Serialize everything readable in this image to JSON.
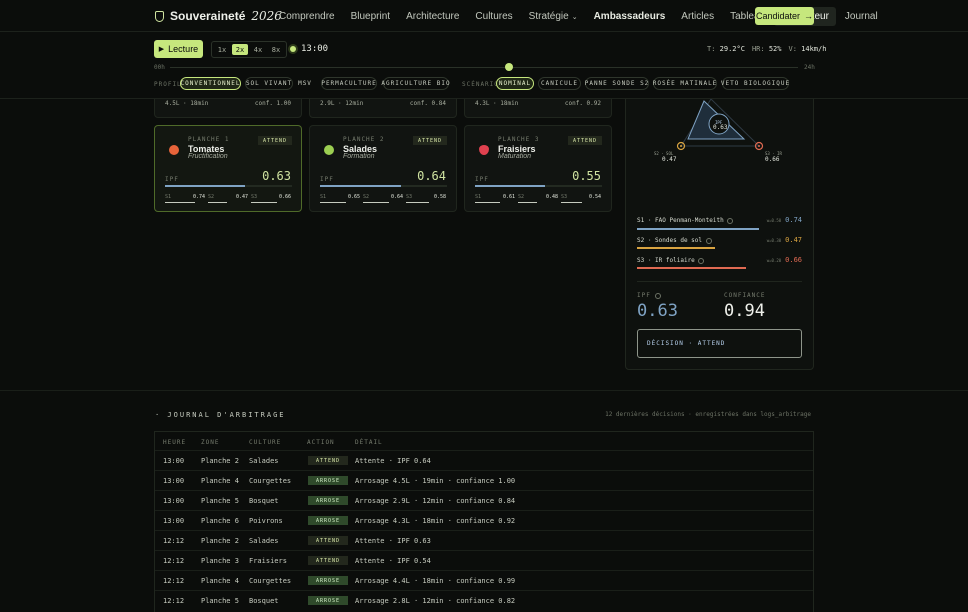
{
  "nav": {
    "brand": "Souveraineté",
    "brand_year": "2026",
    "links": [
      "Comprendre",
      "Blueprint",
      "Architecture",
      "Cultures",
      "Stratégie",
      "Ambassadeurs",
      "Articles",
      "Tableau",
      "Simulateur",
      "Journal"
    ],
    "active": "Simulateur",
    "cta": "Candidater"
  },
  "controls": {
    "play_label": "Lecture",
    "speeds": [
      "1x",
      "2x",
      "4x",
      "8x"
    ],
    "speed_selected": "2x",
    "time": "13:00",
    "weather": {
      "t_label": "T",
      "t": "29.2°C",
      "hr_label": "HR",
      "hr": "52%",
      "v_label": "V",
      "v": "14km/h"
    },
    "timeline_start": "00h",
    "timeline_end": "24h",
    "timeline_progress": 0.54,
    "profil_label": "PROFIL",
    "profils": [
      "CONVENTIONNEL",
      "SOL VIVANT",
      "MSV",
      "PERMACULTURE",
      "AGRICULTURE BIO"
    ],
    "profil_selected": "CONVENTIONNEL",
    "scenario_label": "SCÉNARIO",
    "scenarios": [
      "NOMINAL",
      "CANICULE",
      "PANNE SONDE S2",
      "ROSÉE MATINALE",
      "VETO BIOLOGIQUE"
    ],
    "scenario_selected": "NOMINAL"
  },
  "top_cards": [
    {
      "left": "4.5L · 18min",
      "right": "conf. 1.00"
    },
    {
      "left": "2.9L · 12min",
      "right": "conf. 0.84"
    },
    {
      "left": "4.3L · 18min",
      "right": "conf. 0.92"
    }
  ],
  "plots": [
    {
      "label": "PLANCHE 1",
      "name": "Tomates",
      "stage": "Fructification",
      "state": "ATTEND",
      "ipf_label": "IPF",
      "ipf": "0.63",
      "ipf_value": 0.63,
      "s1_label": "S1",
      "s1": "0.74",
      "s2_label": "S2",
      "s2": "0.47",
      "s3_label": "S3",
      "s3": "0.66",
      "icon_color": "#e8643a",
      "icon": "tomato-icon"
    },
    {
      "label": "PLANCHE 2",
      "name": "Salades",
      "stage": "Formation",
      "state": "ATTEND",
      "ipf_label": "IPF",
      "ipf": "0.64",
      "ipf_value": 0.64,
      "s1_label": "S1",
      "s1": "0.65",
      "s2_label": "S2",
      "s2": "0.64",
      "s3_label": "S3",
      "s3": "0.58",
      "icon_color": "#9ccf52",
      "icon": "salad-icon"
    },
    {
      "label": "PLANCHE 3",
      "name": "Fraisiers",
      "stage": "Maturation",
      "state": "ATTEND",
      "ipf_label": "IPF",
      "ipf": "0.55",
      "ipf_value": 0.55,
      "s1_label": "S1",
      "s1": "0.61",
      "s2_label": "S2",
      "s2": "0.48",
      "s3_label": "S3",
      "s3": "0.54",
      "icon_color": "#e0414f",
      "icon": "strawberry-icon"
    }
  ],
  "panel": {
    "triangle": {
      "center_label": "IPF",
      "center_value": "0.63",
      "s2_label": "S2 · SOL",
      "s2_value": "0.47",
      "s3_label": "S3 · IR",
      "s3_value": "0.66"
    },
    "sensors": [
      {
        "label": "S1 · FAO Penman-Monteith",
        "weight": "w=0.50",
        "value": "0.74",
        "fill": 0.74,
        "color": "#7fa3c4"
      },
      {
        "label": "S2 · Sondes de sol",
        "weight": "w=0.30",
        "value": "0.47",
        "fill": 0.47,
        "color": "#d9a441"
      },
      {
        "label": "S3 · IR foliaire",
        "weight": "w=0.20",
        "value": "0.66",
        "fill": 0.66,
        "color": "#e06a52"
      }
    ],
    "ipf_label": "IPF",
    "ipf_value": "0.63",
    "confiance_label": "CONFIANCE",
    "confiance_value": "0.94",
    "decision": "DÉCISION · ATTEND"
  },
  "journal": {
    "title": "· JOURNAL D'ARBITRAGE",
    "note": "12 dernières décisions · enregistrées dans logs_arbitrage",
    "headers": [
      "HEURE",
      "ZONE",
      "CULTURE",
      "ACTION",
      "DÉTAIL"
    ],
    "rows": [
      {
        "heure": "13:00",
        "zone": "Planche 2",
        "culture": "Salades",
        "action": "ATTEND",
        "detail": "Attente · IPF 0.64"
      },
      {
        "heure": "13:00",
        "zone": "Planche 4",
        "culture": "Courgettes",
        "action": "ARROSE",
        "detail": "Arrosage 4.5L · 19min · confiance 1.00"
      },
      {
        "heure": "13:00",
        "zone": "Planche 5",
        "culture": "Bosquet",
        "action": "ARROSE",
        "detail": "Arrosage 2.9L · 12min · confiance 0.84"
      },
      {
        "heure": "13:00",
        "zone": "Planche 6",
        "culture": "Poivrons",
        "action": "ARROSE",
        "detail": "Arrosage 4.3L · 18min · confiance 0.92"
      },
      {
        "heure": "12:12",
        "zone": "Planche 2",
        "culture": "Salades",
        "action": "ATTEND",
        "detail": "Attente · IPF 0.63"
      },
      {
        "heure": "12:12",
        "zone": "Planche 3",
        "culture": "Fraisiers",
        "action": "ATTEND",
        "detail": "Attente · IPF 0.54"
      },
      {
        "heure": "12:12",
        "zone": "Planche 4",
        "culture": "Courgettes",
        "action": "ARROSE",
        "detail": "Arrosage 4.4L · 18min · confiance 0.99"
      },
      {
        "heure": "12:12",
        "zone": "Planche 5",
        "culture": "Bosquet",
        "action": "ARROSE",
        "detail": "Arrosage 2.8L · 12min · confiance 0.82"
      }
    ]
  }
}
